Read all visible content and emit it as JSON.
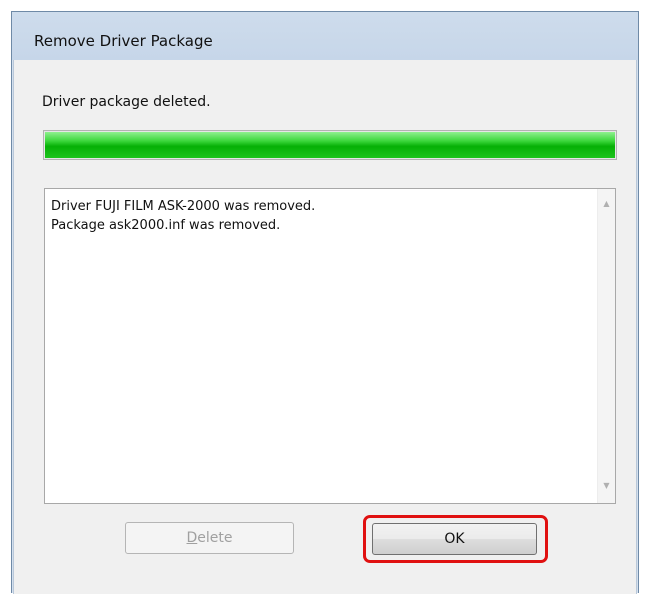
{
  "window": {
    "title": "Remove Driver Package"
  },
  "status": {
    "text": "Driver package deleted."
  },
  "progress": {
    "percent": 100,
    "color": "#06b006"
  },
  "log": {
    "lines": [
      "Driver FUJI FILM ASK-2000 was removed.",
      "Package ask2000.inf was removed."
    ],
    "scroll_up_icon": "scroll-up-arrow",
    "scroll_down_icon": "scroll-down-arrow"
  },
  "buttons": {
    "delete_first": "D",
    "delete_rest": "elete",
    "delete_enabled": false,
    "ok_label": "OK"
  },
  "annotation": {
    "highlight_color": "#e01010",
    "target": "ok-button"
  }
}
